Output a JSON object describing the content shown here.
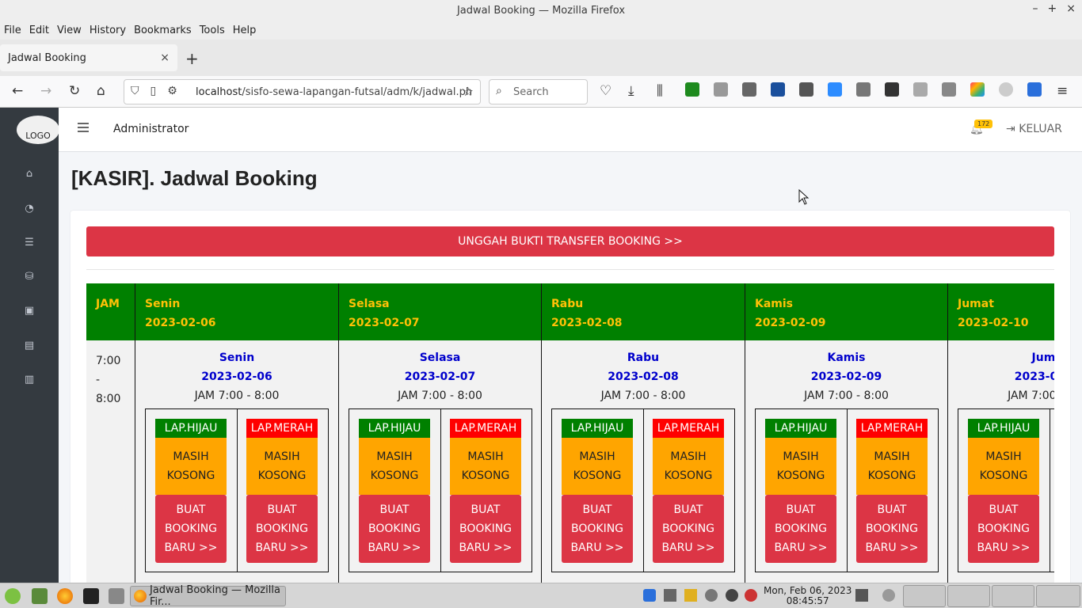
{
  "window": {
    "title": "Jadwal Booking — Mozilla Firefox",
    "controls": [
      "–",
      "+",
      "×"
    ]
  },
  "menubar": [
    "File",
    "Edit",
    "View",
    "History",
    "Bookmarks",
    "Tools",
    "Help"
  ],
  "tab": {
    "title": "Jadwal Booking",
    "close": "×",
    "new": "+"
  },
  "nav": {
    "url_host": "localhost",
    "url_path": "/sisfo-sewa-lapangan-futsal/adm/k/jadwal.ph",
    "search_placeholder": "Search"
  },
  "app": {
    "logo": "LOGO",
    "user": "Administrator",
    "notification_count": "172",
    "logout": "KELUAR",
    "page_title": "[KASIR]. Jadwal Booking",
    "upload_button": "UNGGAH BUKTI TRANSFER BOOKING >>"
  },
  "table": {
    "jam_header": "JAM",
    "jam_row": [
      "7:00",
      "-",
      "8:00"
    ],
    "days": [
      {
        "name": "Senin",
        "date": "2023-02-06"
      },
      {
        "name": "Selasa",
        "date": "2023-02-07"
      },
      {
        "name": "Rabu",
        "date": "2023-02-08"
      },
      {
        "name": "Kamis",
        "date": "2023-02-09"
      },
      {
        "name": "Jumat",
        "date": "2023-02-10"
      }
    ],
    "slot_time": "JAM 7:00 - 8:00",
    "lap_hijau": "LAP.HIJAU",
    "lap_merah": "LAP.MERAH",
    "status_line1": "MASIH",
    "status_line2": "KOSONG",
    "btn_line1": "BUAT",
    "btn_line2": "BOOKING",
    "btn_line3": "BARU >>"
  },
  "colors": {
    "header_green": "#008000",
    "header_text": "#ffc107",
    "lap_hijau": "#008000",
    "lap_merah": "#ff0000",
    "status_bg": "#ffa500",
    "danger": "#dc3545",
    "sidebar": "#343a40"
  },
  "taskbar": {
    "active_task": "Jadwal Booking — Mozilla Fir...",
    "clock_date": "Mon, Feb 06, 2023",
    "clock_time": "08:45:57"
  }
}
